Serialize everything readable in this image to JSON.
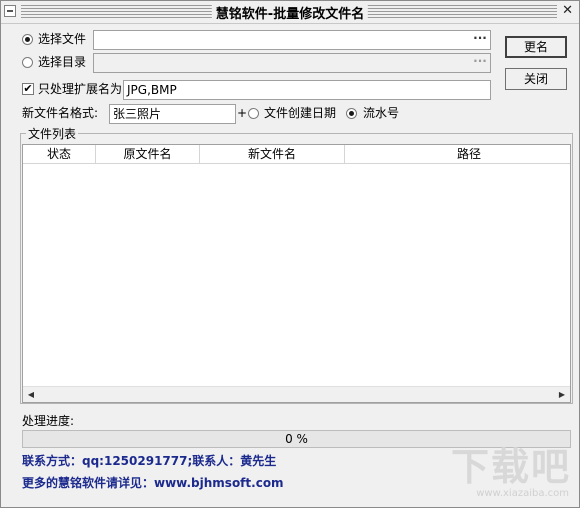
{
  "window": {
    "title": "慧铭软件-批量修改文件名"
  },
  "source": {
    "file_option": "选择文件",
    "dir_option": "选择目录",
    "file_path": "",
    "dir_path": "",
    "browse_label": "···"
  },
  "extension": {
    "label": "只处理扩展名为",
    "value": "JPG,BMP",
    "checked": true
  },
  "format": {
    "label": "新文件名格式:",
    "value": "张三照片",
    "plus": "+",
    "option_date": "文件创建日期",
    "option_serial": "流水号",
    "selected": "流水号"
  },
  "buttons": {
    "rename": "更名",
    "close": "关闭"
  },
  "file_list": {
    "group_title": "文件列表",
    "columns": [
      "状态",
      "原文件名",
      "新文件名",
      "路径"
    ],
    "rows": []
  },
  "progress": {
    "label": "处理进度:",
    "percent": 0,
    "text": "0 %"
  },
  "contact": {
    "line1": "联系方式：qq:1250291777;联系人：黄先生",
    "line2": "更多的慧铭软件请详见：www.bjhmsoft.com"
  },
  "watermark": {
    "logo": "下载吧",
    "url": "www.xiazaiba.com"
  },
  "colors": {
    "contact_text": "#1c2a8e",
    "progress_fill": "#06b025"
  }
}
